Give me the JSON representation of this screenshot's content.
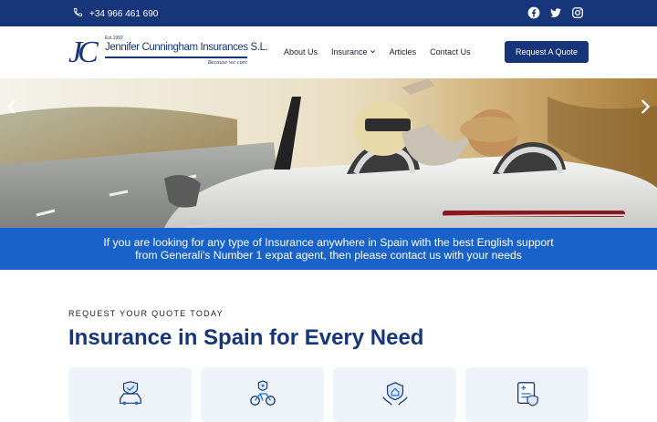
{
  "topbar": {
    "phone": "+34 966 461 690",
    "phone_icon": "phone-icon",
    "socials": [
      "facebook-icon",
      "twitter-icon",
      "instagram-icon"
    ]
  },
  "logo": {
    "monogram": "JC",
    "est": "Est.1992",
    "company": "Jennifer Cunningham Insurances S.L.",
    "tagline": "Because we care"
  },
  "nav": {
    "items": [
      "About Us",
      "Insurance",
      "Articles",
      "Contact Us"
    ],
    "cta": "Request A Quote"
  },
  "hero": {
    "prev_icon": "chevron-left-icon",
    "next_icon": "chevron-right-icon"
  },
  "banner": {
    "line1": "If you are looking for any type of Insurance anywhere in Spain with the best English support",
    "line2": "from Generali's Number 1 expat agent, then please contact us with your needs"
  },
  "section": {
    "eyebrow": "REQUEST YOUR QUOTE TODAY",
    "heading": "Insurance in Spain for Every Need"
  },
  "cards": [
    "car-insurance-icon",
    "motorbike-insurance-icon",
    "home-protection-icon",
    "document-insurance-icon"
  ],
  "colors": {
    "primary": "#16357a",
    "banner": "#1862c9",
    "card_bg": "#eef3fa",
    "icon_accent": "#1f6fe0"
  }
}
